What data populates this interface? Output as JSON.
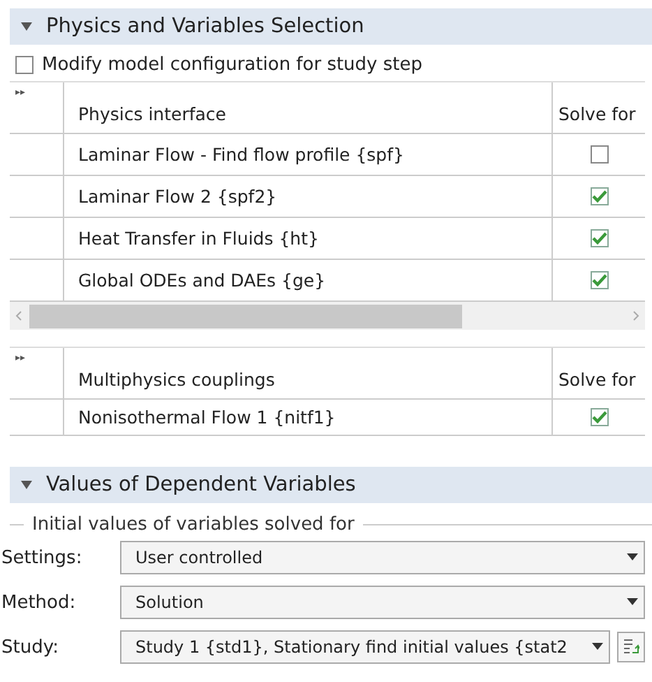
{
  "sections": [
    {
      "title": "Physics and Variables Selection",
      "expanded": true
    },
    {
      "title": "Values of Dependent Variables",
      "expanded": true
    }
  ],
  "modify_config": {
    "label": "Modify model configuration for study step",
    "checked": false
  },
  "physics_table": {
    "expand_glyph": "▸▸",
    "columns": [
      "Physics interface",
      "Solve for"
    ],
    "rows": [
      {
        "name": "Laminar Flow - Find flow profile {spf}",
        "checked": false
      },
      {
        "name": "Laminar Flow 2 {spf2}",
        "checked": true
      },
      {
        "name": "Heat Transfer in Fluids {ht}",
        "checked": true
      },
      {
        "name": "Global ODEs and DAEs {ge}",
        "checked": true
      }
    ]
  },
  "couplings_table": {
    "expand_glyph": "▸▸",
    "columns": [
      "Multiphysics couplings",
      "Solve for"
    ],
    "rows": [
      {
        "name": "Nonisothermal Flow 1 {nitf1}",
        "checked": true
      }
    ]
  },
  "initial_values": {
    "group_label": "Initial values of variables solved for",
    "fields": [
      {
        "label": "Settings:",
        "value": "User controlled"
      },
      {
        "label": "Method:",
        "value": "Solution"
      },
      {
        "label": "Study:",
        "value": "Study 1 {std1}, Stationary find initial values {stat2",
        "has_button": true
      }
    ]
  }
}
